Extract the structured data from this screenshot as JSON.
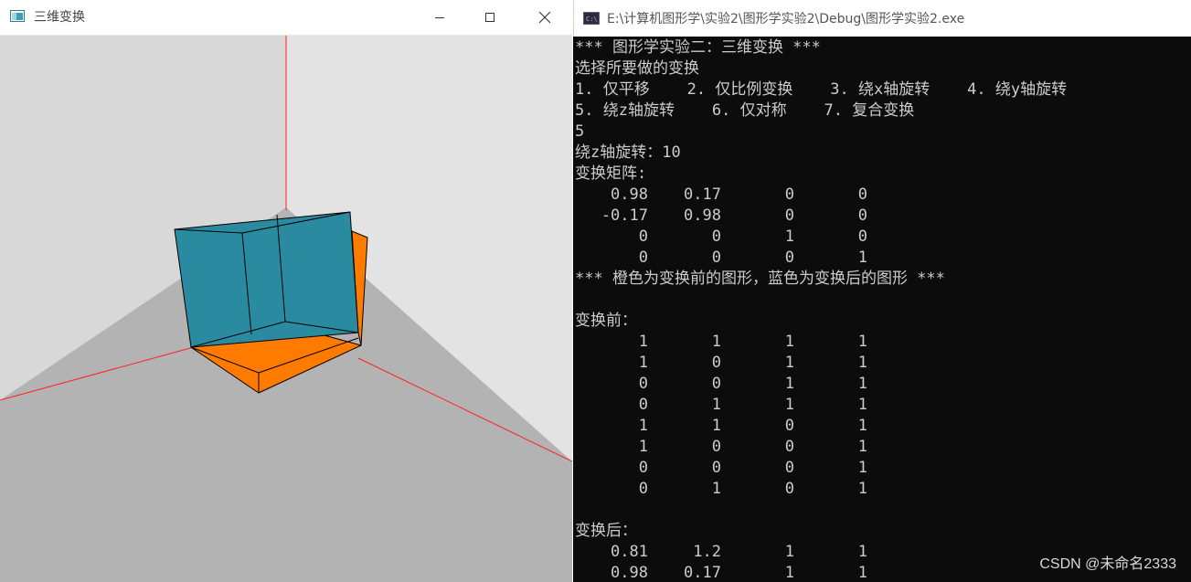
{
  "gl_window": {
    "title": "三维变换",
    "icon": "opengl-app-icon",
    "controls": {
      "minimize": "minimize-icon",
      "maximize": "maximize-icon",
      "close": "close-icon"
    },
    "colors": {
      "left_wall": "#d8d8d8",
      "right_wall": "#e3e3e3",
      "floor": "#b3b3b3",
      "axis": "#ff2020",
      "cube_before": "#ff7b00",
      "cube_after": "#2a8aa0"
    }
  },
  "console": {
    "title": "E:\\计算机图形学\\实验2\\图形学实验2\\Debug\\图形学实验2.exe",
    "icon": "console-app-icon",
    "header": "*** 图形学实验二：三维变换 ***",
    "prompt": "选择所要做的变换",
    "options_line1": "1. 仅平移    2. 仅比例变换    3. 绕x轴旋转    4. 绕y轴旋转",
    "options_line2": "5. 绕z轴旋转    6. 仅对称    7. 复合变换",
    "choice": "5",
    "input_line": "绕z轴旋转：10",
    "matrix_label": "变换矩阵:",
    "matrix": [
      [
        "0.98",
        "0.17",
        "0",
        "0"
      ],
      [
        "-0.17",
        "0.98",
        "0",
        "0"
      ],
      [
        "0",
        "0",
        "1",
        "0"
      ],
      [
        "0",
        "0",
        "0",
        "1"
      ]
    ],
    "note": "*** 橙色为变换前的图形，蓝色为变换后的图形 ***",
    "before_label": "变换前：",
    "before": [
      [
        "1",
        "1",
        "1",
        "1"
      ],
      [
        "1",
        "0",
        "1",
        "1"
      ],
      [
        "0",
        "0",
        "1",
        "1"
      ],
      [
        "0",
        "1",
        "1",
        "1"
      ],
      [
        "1",
        "1",
        "0",
        "1"
      ],
      [
        "1",
        "0",
        "0",
        "1"
      ],
      [
        "0",
        "0",
        "0",
        "1"
      ],
      [
        "0",
        "1",
        "0",
        "1"
      ]
    ],
    "after_label": "变换后：",
    "after": [
      [
        "0.81",
        "1.2",
        "1",
        "1"
      ],
      [
        "0.98",
        "0.17",
        "1",
        "1"
      ]
    ]
  },
  "watermark": "CSDN @未命名2333"
}
